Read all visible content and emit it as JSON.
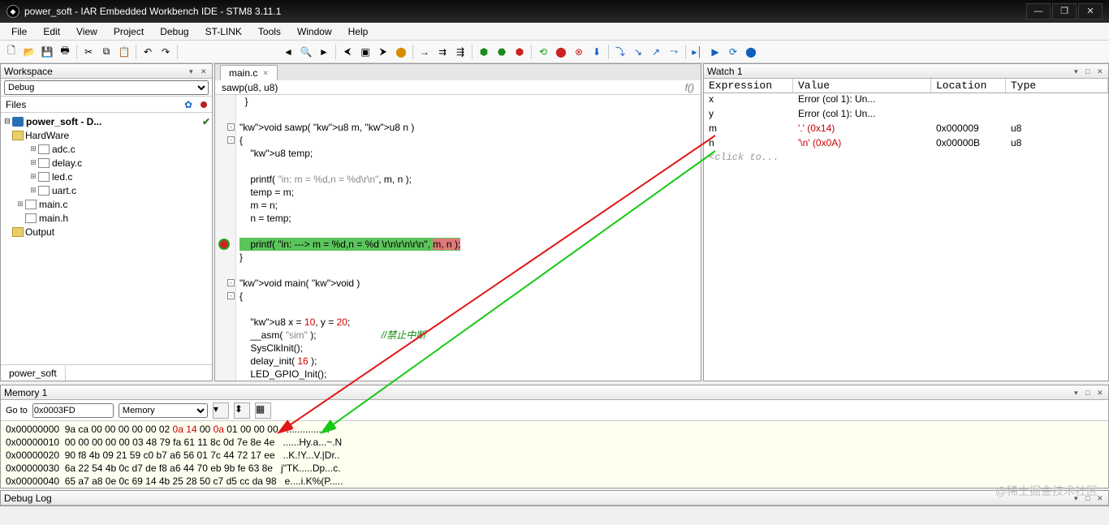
{
  "window": {
    "title": "power_soft - IAR Embedded Workbench IDE - STM8 3.11.1"
  },
  "menu": {
    "items": [
      "File",
      "Edit",
      "View",
      "Project",
      "Debug",
      "ST-LINK",
      "Tools",
      "Window",
      "Help"
    ]
  },
  "workspace": {
    "title": "Workspace",
    "config": "Debug",
    "files_label": "Files",
    "project": "power_soft - D...",
    "tree": [
      {
        "indent": 1,
        "label": "HardWare",
        "icon": "fold",
        "exp": "⊟"
      },
      {
        "indent": 2,
        "label": "adc.c",
        "icon": "cfile",
        "exp": "⊞"
      },
      {
        "indent": 2,
        "label": "delay.c",
        "icon": "cfile",
        "exp": "⊞"
      },
      {
        "indent": 2,
        "label": "led.c",
        "icon": "cfile",
        "exp": "⊞"
      },
      {
        "indent": 2,
        "label": "uart.c",
        "icon": "cfile",
        "exp": "⊞"
      },
      {
        "indent": 1,
        "label": "main.c",
        "icon": "cfile",
        "exp": "⊞"
      },
      {
        "indent": 1,
        "label": "main.h",
        "icon": "cfile",
        "exp": ""
      },
      {
        "indent": 1,
        "label": "Output",
        "icon": "fold",
        "exp": "⊞"
      }
    ],
    "tab": "power_soft"
  },
  "editor": {
    "tab": "main.c",
    "crumb": "sawp(u8, u8)",
    "code_lines": [
      "  }",
      "",
      "void sawp( u8 m, u8 n )",
      "{",
      "    u8 temp;",
      "",
      "    printf( \"in: m = %d,n = %d\\r\\n\", m, n );",
      "    temp = m;",
      "    m = n;",
      "    n = temp;",
      "",
      "HL:    printf( \"in: ---> m = %d,n = %d \\r\\n\\r\\n\\r\\n\", m, n );",
      "}",
      "",
      "void main( void )",
      "{",
      "",
      "    u8 x = 10, y = 20;",
      "    __asm( \"sim\" );                        //禁止中断",
      "    SysClkInit();",
      "    delay_init( 16 );",
      "    LED_GPIO_Init();"
    ]
  },
  "watch": {
    "title": "Watch 1",
    "headers": {
      "exp": "Expression",
      "val": "Value",
      "loc": "Location",
      "typ": "Type"
    },
    "rows": [
      {
        "exp": "x",
        "val": "Error (col 1): Un...",
        "loc": "",
        "typ": "",
        "red": false
      },
      {
        "exp": "y",
        "val": "Error (col 1): Un...",
        "loc": "",
        "typ": "",
        "red": false
      },
      {
        "exp": "m",
        "val": "'.' (0x14)",
        "loc": "0x000009",
        "typ": "u8",
        "red": true
      },
      {
        "exp": "n",
        "val": "'\\n' (0x0A)",
        "loc": "0x00000B",
        "typ": "u8",
        "red": true
      }
    ],
    "click": "<click to..."
  },
  "memory": {
    "title": "Memory 1",
    "goto_label": "Go to",
    "goto_value": "0x0003FD",
    "space": "Memory",
    "lines": [
      {
        "addr": "0x00000000",
        "hex_pre": "9a ca 00 00 00 00 00 02 ",
        "hex_r1": "0a 14",
        "hex_mid": " 00 ",
        "hex_r2": "0a",
        "hex_post": " 01 00 00 00",
        "ascii": "................"
      },
      {
        "addr": "0x00000010",
        "hex_pre": "00 00 00 00 00 03 48 79 fa 61 11 8c 0d 7e 8e 4e",
        "hex_r1": "",
        "hex_mid": "",
        "hex_r2": "",
        "hex_post": "",
        "ascii": "......Hy.a...~.N"
      },
      {
        "addr": "0x00000020",
        "hex_pre": "90 f8 4b 09 21 59 c0 b7 a6 56 01 7c 44 72 17 ee",
        "hex_r1": "",
        "hex_mid": "",
        "hex_r2": "",
        "hex_post": "",
        "ascii": "..K.!Y...V.|Dr.."
      },
      {
        "addr": "0x00000030",
        "hex_pre": "6a 22 54 4b 0c d7 de f8 a6 44 70 eb 9b fe 63 8e",
        "hex_r1": "",
        "hex_mid": "",
        "hex_r2": "",
        "hex_post": "",
        "ascii": "j\"TK.....Dp...c."
      },
      {
        "addr": "0x00000040",
        "hex_pre": "65 a7 a8 0e 0c 69 14 4b 25 28 50 c7 d5 cc da 98",
        "hex_r1": "",
        "hex_mid": "",
        "hex_r2": "",
        "hex_post": "",
        "ascii": "e....i.K%(P....."
      }
    ]
  },
  "debuglog": {
    "title": "Debug Log"
  },
  "watermark": "@稀土掘金技术社区"
}
